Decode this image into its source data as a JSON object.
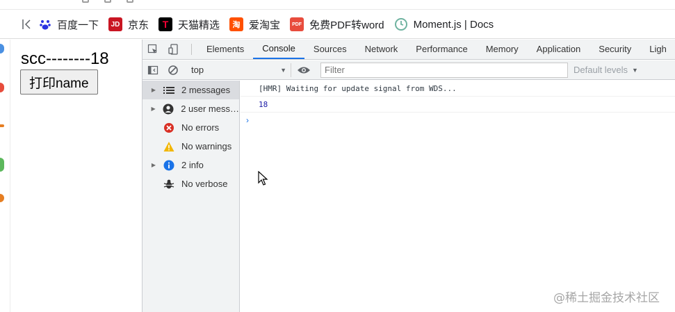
{
  "bookmarks": [
    {
      "label": "百度一下",
      "icon": "baidu-paw-icon",
      "color": "#2932e1"
    },
    {
      "label": "京东",
      "icon": "jd-logo-icon",
      "color": "#c91623"
    },
    {
      "label": "天猫精选",
      "icon": "tmall-logo-icon",
      "color": "#ff0036"
    },
    {
      "label": "爱淘宝",
      "icon": "taobao-logo-icon",
      "color": "#ff5000"
    },
    {
      "label": "免费PDF转word",
      "icon": "pdf-logo-icon",
      "color": "#e84c3d"
    },
    {
      "label": "Moment.js | Docs",
      "icon": "clock-icon",
      "color": "#6fb3a0"
    }
  ],
  "page": {
    "text": "scc--------18",
    "button_label": "打印name"
  },
  "devtools": {
    "tabs": [
      "Elements",
      "Console",
      "Sources",
      "Network",
      "Performance",
      "Memory",
      "Application",
      "Security",
      "Ligh"
    ],
    "active_tab": "Console",
    "context": "top",
    "filter_placeholder": "Filter",
    "levels_label": "Default levels",
    "sidebar": [
      {
        "label": "2 messages",
        "icon": "list-icon",
        "expandable": true,
        "selected": true
      },
      {
        "label": "2 user mess…",
        "icon": "user-icon",
        "expandable": true,
        "selected": false
      },
      {
        "label": "No errors",
        "icon": "error-icon",
        "expandable": false,
        "selected": false
      },
      {
        "label": "No warnings",
        "icon": "warning-icon",
        "expandable": false,
        "selected": false
      },
      {
        "label": "2 info",
        "icon": "info-icon",
        "expandable": true,
        "selected": false
      },
      {
        "label": "No verbose",
        "icon": "bug-icon",
        "expandable": false,
        "selected": false
      }
    ],
    "console_lines": [
      {
        "text": "[HMR] Waiting for update signal from WDS...",
        "type": "log"
      },
      {
        "text": "18",
        "type": "number"
      }
    ],
    "prompt_symbol": "›"
  },
  "watermark": "@稀土掘金技术社区",
  "colors": {
    "accent": "#1a73e8",
    "error": "#d93025",
    "warning": "#f2b600",
    "info": "#1a73e8"
  }
}
